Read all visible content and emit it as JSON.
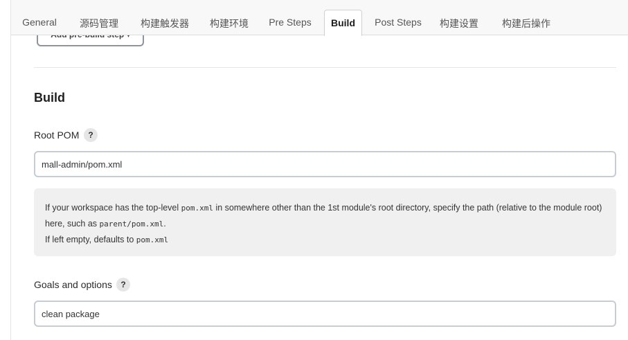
{
  "tabs": [
    {
      "label": "General",
      "active": false
    },
    {
      "label": "源码管理",
      "active": false
    },
    {
      "label": "构建触发器",
      "active": false
    },
    {
      "label": "构建环境",
      "active": false
    },
    {
      "label": "Pre Steps",
      "active": false
    },
    {
      "label": "Build",
      "active": true
    },
    {
      "label": "Post Steps",
      "active": false
    },
    {
      "label": "构建设置",
      "active": false
    },
    {
      "label": "构建后操作",
      "active": false
    }
  ],
  "pre_steps": {
    "add_button_label": "Add pre-build step",
    "caret": "▾"
  },
  "build": {
    "section_title": "Build",
    "root_pom": {
      "label": "Root POM",
      "help": "?",
      "value": "mall-admin/pom.xml"
    },
    "help_text": {
      "line1_pre": "If your workspace has the top-level ",
      "line1_code": "pom.xml",
      "line1_post": " in somewhere other than the 1st module's root directory, specify the path (relative to the module root) here, such as ",
      "line1_code2": "parent/pom.xml",
      "line1_end": ".",
      "line2_pre": "If left empty, defaults to ",
      "line2_code": "pom.xml"
    },
    "goals": {
      "label": "Goals and options",
      "help": "?",
      "value": "clean package"
    }
  },
  "colors": {
    "tab_bar_bg": "#f8f8f8",
    "help_box_bg": "#f0f0f0",
    "input_border": "#c5ccd3",
    "active_tab_text": "#1c1c1c"
  }
}
